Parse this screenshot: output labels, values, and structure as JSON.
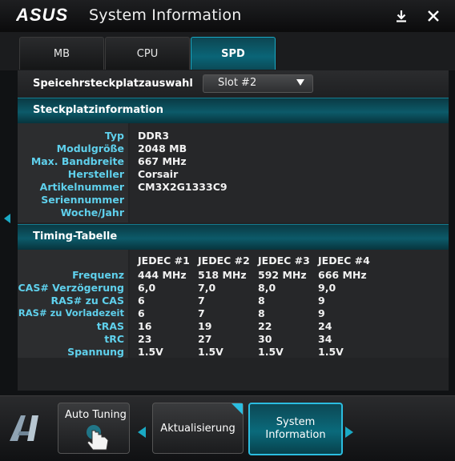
{
  "window": {
    "brand": "ASUS",
    "title": "System Information"
  },
  "tabs": [
    {
      "label": "MB",
      "active": false
    },
    {
      "label": "CPU",
      "active": false
    },
    {
      "label": "SPD",
      "active": true
    }
  ],
  "slot_selector": {
    "label": "Speicehrsteckplatzauswahl",
    "selected": "Slot #2"
  },
  "slot_info": {
    "header": "Steckplatzinformation",
    "rows": [
      {
        "label": "Typ",
        "value": "DDR3"
      },
      {
        "label": "Modulgröße",
        "value": "2048 MB"
      },
      {
        "label": "Max. Bandbreite",
        "value": "667 MHz"
      },
      {
        "label": "Hersteller",
        "value": "Corsair"
      },
      {
        "label": "Artikelnummer",
        "value": "CM3X2G1333C9"
      },
      {
        "label": "Seriennummer",
        "value": ""
      },
      {
        "label": "Woche/Jahr",
        "value": ""
      }
    ]
  },
  "timing": {
    "header": "Timing-Tabelle",
    "columns": [
      "JEDEC #1",
      "JEDEC #2",
      "JEDEC #3",
      "JEDEC #4"
    ],
    "rows": [
      {
        "label": "Frequenz",
        "values": [
          "444 MHz",
          "518 MHz",
          "592 MHz",
          "666 MHz"
        ]
      },
      {
        "label": "CAS# Verzögerung",
        "values": [
          "6,0",
          "7,0",
          "8,0",
          "9,0"
        ]
      },
      {
        "label": "RAS# zu CAS",
        "values": [
          "6",
          "7",
          "8",
          "9"
        ]
      },
      {
        "label": "RAS# zu Vorladezeit",
        "values": [
          "6",
          "7",
          "8",
          "9"
        ]
      },
      {
        "label": "tRAS",
        "values": [
          "16",
          "19",
          "22",
          "24"
        ]
      },
      {
        "label": "tRC",
        "values": [
          "23",
          "27",
          "30",
          "34"
        ]
      },
      {
        "label": "Spannung",
        "values": [
          "1.5V",
          "1.5V",
          "1.5V",
          "1.5V"
        ]
      }
    ]
  },
  "bottom": {
    "auto_tuning": "Auto Tuning",
    "update": "Aktualisierung",
    "system_info_line1": "System",
    "system_info_line2": "Information"
  },
  "colors": {
    "accent": "#0a6577",
    "label": "#5fd0ec",
    "value": "#f2f2f2"
  }
}
